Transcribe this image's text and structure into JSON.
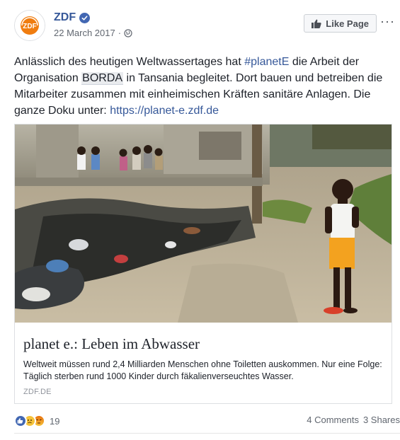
{
  "post": {
    "page_name": "ZDF",
    "date": "22 March 2017",
    "separator": "·",
    "like_page_label": "Like Page",
    "more_label": "···",
    "text": {
      "part1": "Anlässlich des heutigen Weltwassertages hat ",
      "hashtag": "#planetE",
      "part2": " die Arbeit der Organisation ",
      "mention": "BORDA",
      "part3": " in Tansania begleitet. Dort bauen und betreiben die Mitarbeiter zusammen mit einheimischen Kräften sanitäre Anlagen. Die ganze Doku unter: ",
      "link": "https://planet-e.zdf.de"
    }
  },
  "link_preview": {
    "title": "planet e.: Leben im Abwasser",
    "description": "Weltweit müssen rund 2,4 Milliarden Menschen ohne Toiletten auskommen. Nur eine Folge: Täglich sterben rund 1000 Kinder durch fäkalienverseuchtes Wasser.",
    "domain": "ZDF.DE",
    "image_subject": "child standing beside polluted wastewater channel"
  },
  "footer": {
    "reaction_icons": [
      "like-icon",
      "sad-icon",
      "angry-icon"
    ],
    "reaction_count": "19",
    "comments": "4 Comments",
    "shares": "3 Shares"
  },
  "colors": {
    "link_blue": "#365899",
    "zdf_orange": "#f07d10",
    "verified_blue": "#4267b2",
    "meta_gray": "#616770"
  }
}
